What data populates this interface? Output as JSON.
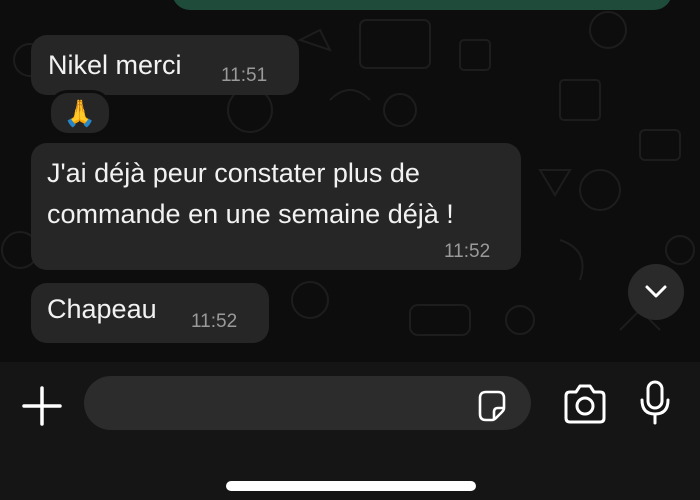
{
  "messages": [
    {
      "text_lines": [
        "Nikel merci"
      ],
      "time": "11:51",
      "reaction": "🙏"
    },
    {
      "text_lines": [
        "J'ai déjà peur constater plus de",
        "commande en une semaine déjà !"
      ],
      "time": "11:52"
    },
    {
      "text_lines": [
        "Chapeau"
      ],
      "time": "11:52"
    }
  ],
  "composer": {
    "value": "",
    "placeholder": ""
  },
  "icons": {
    "plus": "plus-icon",
    "sticker": "sticker-icon",
    "camera": "camera-icon",
    "mic": "microphone-icon",
    "scroll": "chevron-down-icon"
  },
  "colors": {
    "incoming_bubble": "#262626",
    "outgoing_bubble": "#1f4b3a",
    "background": "#0d0d0d",
    "time_text": "#9a9a9a"
  }
}
